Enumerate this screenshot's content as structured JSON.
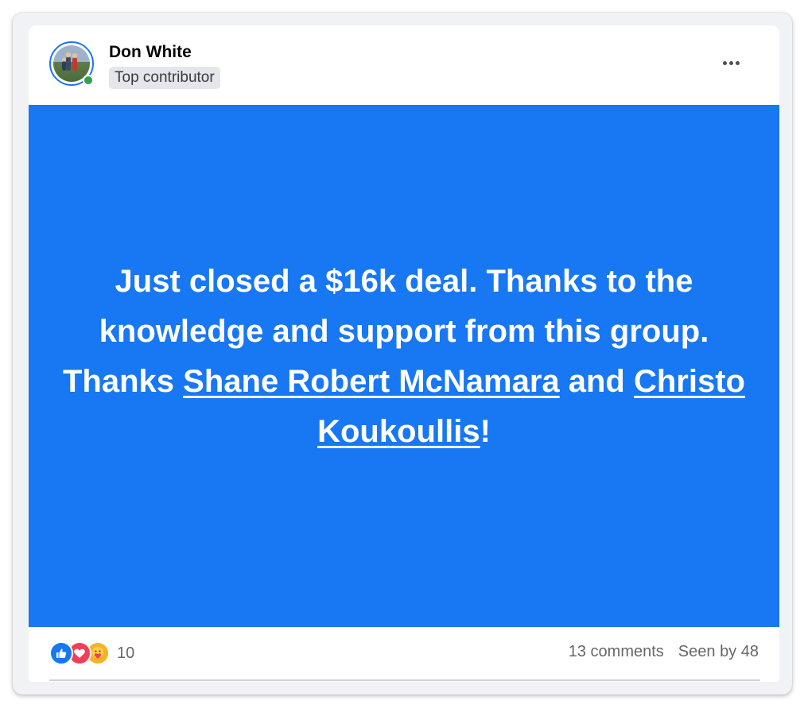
{
  "post": {
    "author": {
      "name": "Don White",
      "badge": "Top contributor",
      "online": true
    },
    "background_color": "#1877f2",
    "text": {
      "part1": "Just closed a $16k deal. Thanks to the knowledge and support from this group. Thanks ",
      "mention1": "Shane Robert McNamara",
      "part2": " and ",
      "mention2": "Christo Koukoullis",
      "part3": "!"
    },
    "reactions": {
      "icons": [
        "like-icon",
        "love-icon",
        "care-icon"
      ],
      "count": "10"
    },
    "comments": "13 comments",
    "seen_by": "Seen by 48"
  },
  "colors": {
    "accent": "#1877f2",
    "online": "#31a24c",
    "like": "#1877f2",
    "love": "#f33e58",
    "care": "#f7b125"
  }
}
